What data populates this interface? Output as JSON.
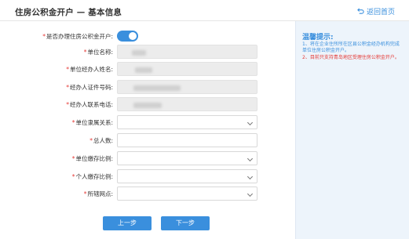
{
  "header": {
    "title": "住房公积金开户 — 基本信息",
    "back_label": "返回首页"
  },
  "form": {
    "fields": [
      {
        "label": "是否办理住房公积金开户:",
        "required": "*",
        "type": "toggle",
        "value": "on"
      },
      {
        "label": "单位名称:",
        "required": "*",
        "type": "readonly",
        "value": ""
      },
      {
        "label": "单位经办人姓名:",
        "required": "*",
        "type": "readonly",
        "value": ""
      },
      {
        "label": "经办人证件号码:",
        "required": "*",
        "type": "readonly",
        "value": ""
      },
      {
        "label": "经办人联系电话:",
        "required": "*",
        "type": "readonly",
        "value": ""
      },
      {
        "label": "单位隶属关系:",
        "required": "*",
        "type": "select",
        "value": ""
      },
      {
        "label": "总人数:",
        "required": "*",
        "type": "text",
        "value": ""
      },
      {
        "label": "单位缴存比例:",
        "required": "*",
        "type": "select",
        "value": ""
      },
      {
        "label": "个人缴存比例:",
        "required": "*",
        "type": "select",
        "value": ""
      },
      {
        "label": "所辖网点:",
        "required": "*",
        "type": "select",
        "value": ""
      }
    ],
    "prev_label": "上一步",
    "next_label": "下一步"
  },
  "sidebar": {
    "title": "温馨提示:",
    "tips": [
      "1、将在企业住所所在区县公积金经办机构完成单位住房公积金开户。",
      "2、目前只支持青岛地区受理住房公积金开户。"
    ]
  },
  "colors": {
    "accent": "#3a8fdd",
    "required": "#e53935",
    "sidebar_bg": "#edf4fb"
  },
  "icons": {
    "back": "return-arrow-icon",
    "select": "chevron-down-icon"
  }
}
